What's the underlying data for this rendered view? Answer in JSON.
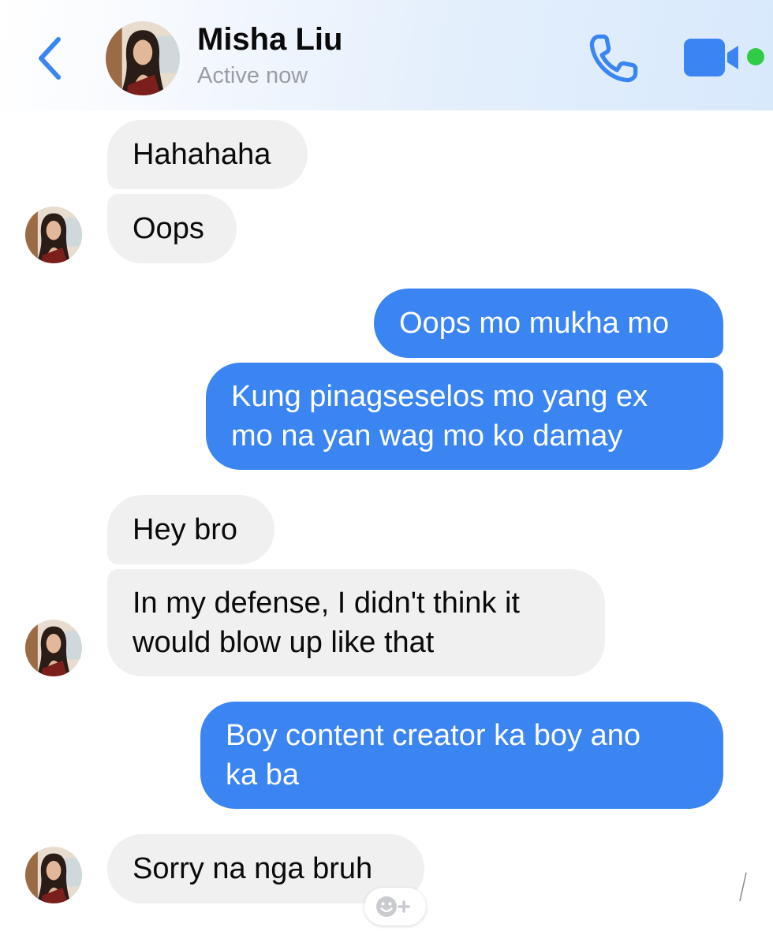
{
  "header": {
    "contact_name": "Misha Liu",
    "status": "Active now",
    "back_icon": "chevron-left-icon",
    "call_icon": "phone-icon",
    "video_icon": "video-camera-icon",
    "online_indicator": "online-status-dot"
  },
  "messages": [
    {
      "sender": "contact",
      "lines": [
        "Hahahaha"
      ]
    },
    {
      "sender": "contact",
      "lines": [
        "Oops"
      ]
    },
    {
      "sender": "me",
      "lines": [
        "Oops mo mukha mo"
      ]
    },
    {
      "sender": "me",
      "lines": [
        "Kung pinagseselos mo yang ex",
        "mo na yan wag mo ko damay"
      ]
    },
    {
      "sender": "contact",
      "lines": [
        "Hey bro"
      ]
    },
    {
      "sender": "contact",
      "lines": [
        "In my defense, I didn't think it",
        "would blow up like that"
      ]
    },
    {
      "sender": "me",
      "lines": [
        "Boy content creator ka boy ano",
        "ka ba"
      ]
    },
    {
      "sender": "contact",
      "lines": [
        "Sorry na nga bruh"
      ]
    }
  ],
  "reaction_button": {
    "icon": "add-reaction-icon"
  },
  "colors": {
    "accent": "#3a85f1",
    "incoming_bubble": "#f0f0f0",
    "outgoing_bubble": "#3a85f1",
    "online_dot": "#31cc46",
    "status_text": "#9a9da3"
  }
}
